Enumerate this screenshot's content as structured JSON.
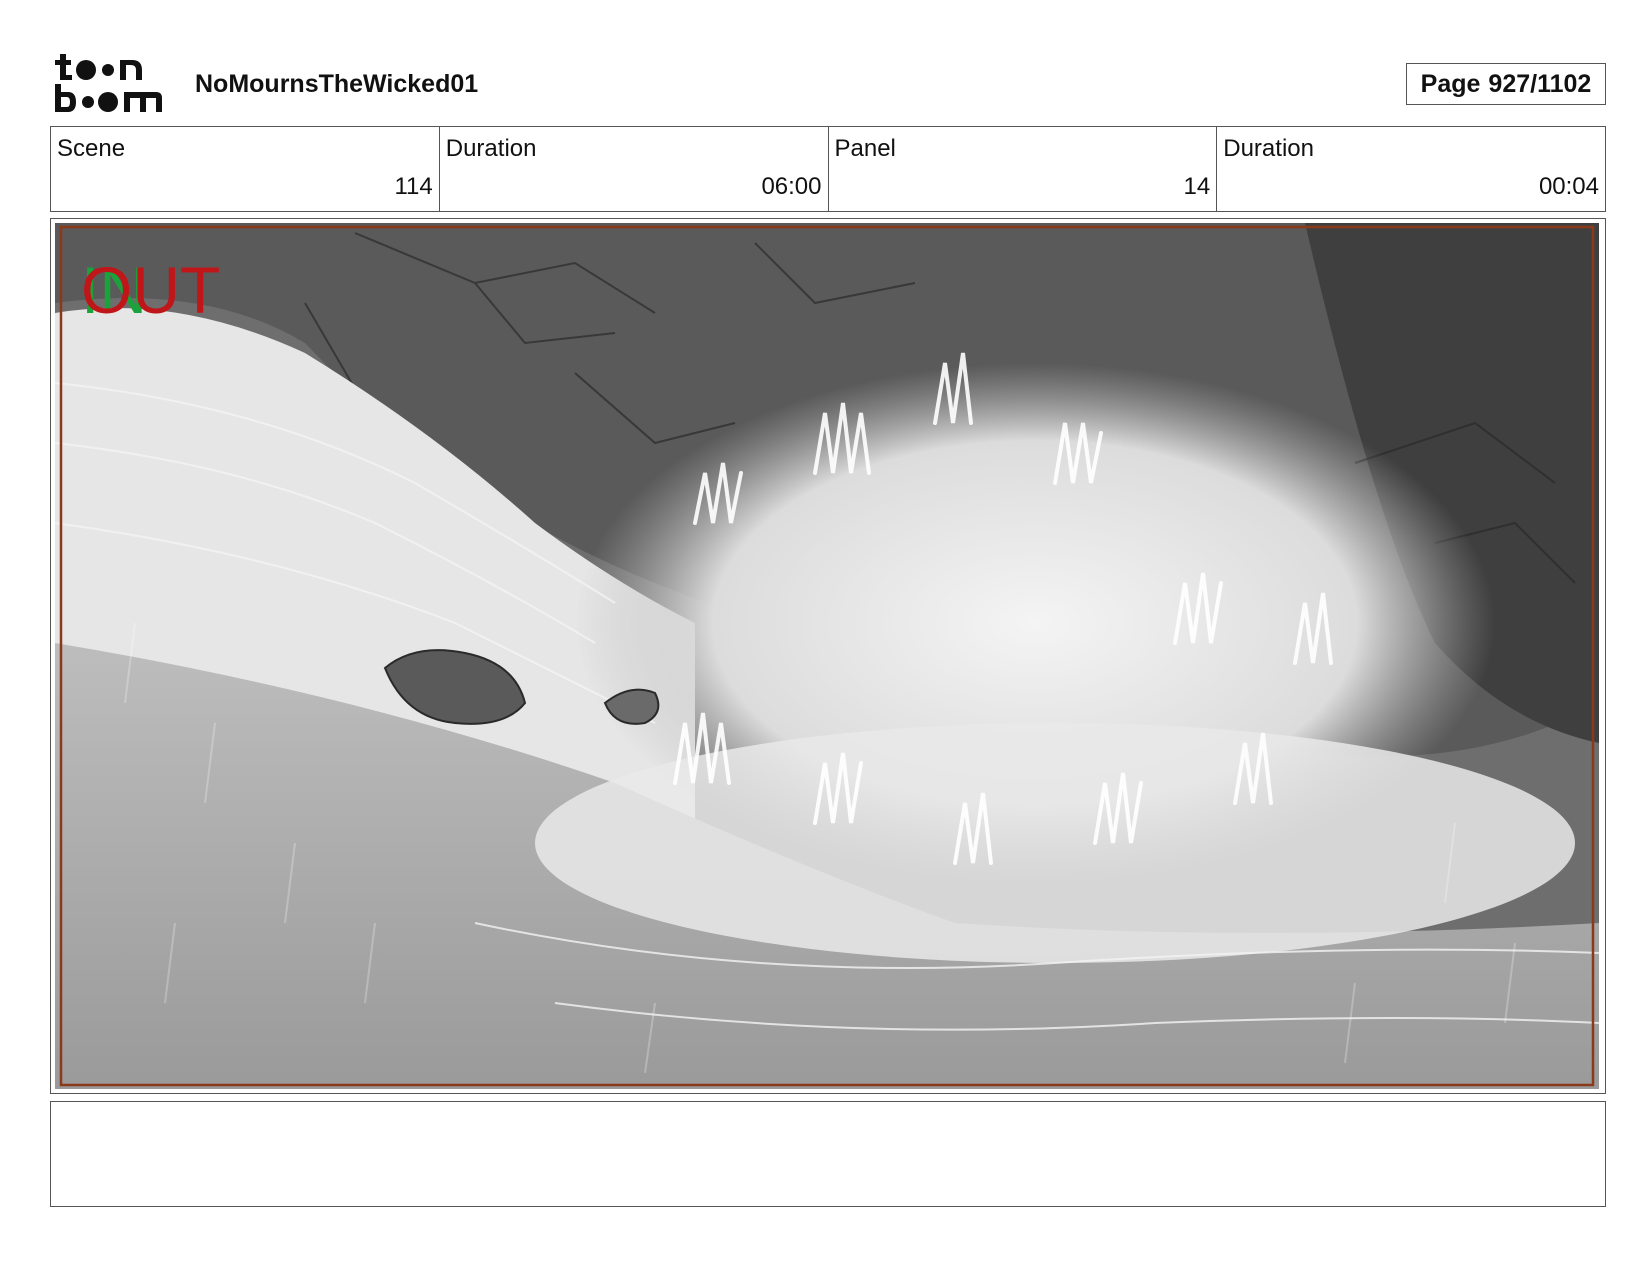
{
  "header": {
    "logo_text": "toon boom",
    "project_title": "NoMournsTheWicked01",
    "page_label": "Page",
    "page_number": "927/1102"
  },
  "info": {
    "scene_label": "Scene",
    "scene_value": "114",
    "scene_duration_label": "Duration",
    "scene_duration_value": "06:00",
    "panel_label": "Panel",
    "panel_value": "14",
    "panel_duration_label": "Duration",
    "panel_duration_value": "00:04"
  },
  "panel": {
    "in_marker": "IN",
    "out_marker": "OUT",
    "in_color": "#1aa33a",
    "out_color": "#c0161a",
    "frame_color": "#8a3a1a"
  },
  "notes": {
    "text": ""
  }
}
